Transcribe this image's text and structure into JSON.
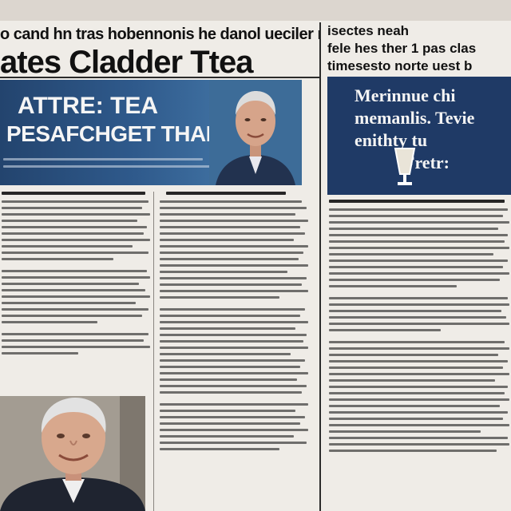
{
  "newspaper": {
    "top_line": "o cand hn tras hobennonis he danol ueciler raiten",
    "main_headline": "ates Cladder Ttea",
    "right_headline": {
      "line1": "isectes neah",
      "line2": "fele hes ther 1 pas clas",
      "line3": "timesesto norte uest b"
    },
    "banner": {
      "line1": "ATTRE: TEA",
      "line2": "PESAFCHGET THAIR"
    },
    "right_panel": {
      "line1": "Merinnue chi",
      "line2": "memanlis. Tevie",
      "line3": "enithty tu",
      "line4": "Fretr:"
    },
    "colors": {
      "paper": "#efece7",
      "banner_blue": "#2f5a8c",
      "panel_navy": "#1f3a66",
      "ink": "#111111"
    },
    "icons": {
      "panel_graphic": "glass-icon"
    }
  }
}
